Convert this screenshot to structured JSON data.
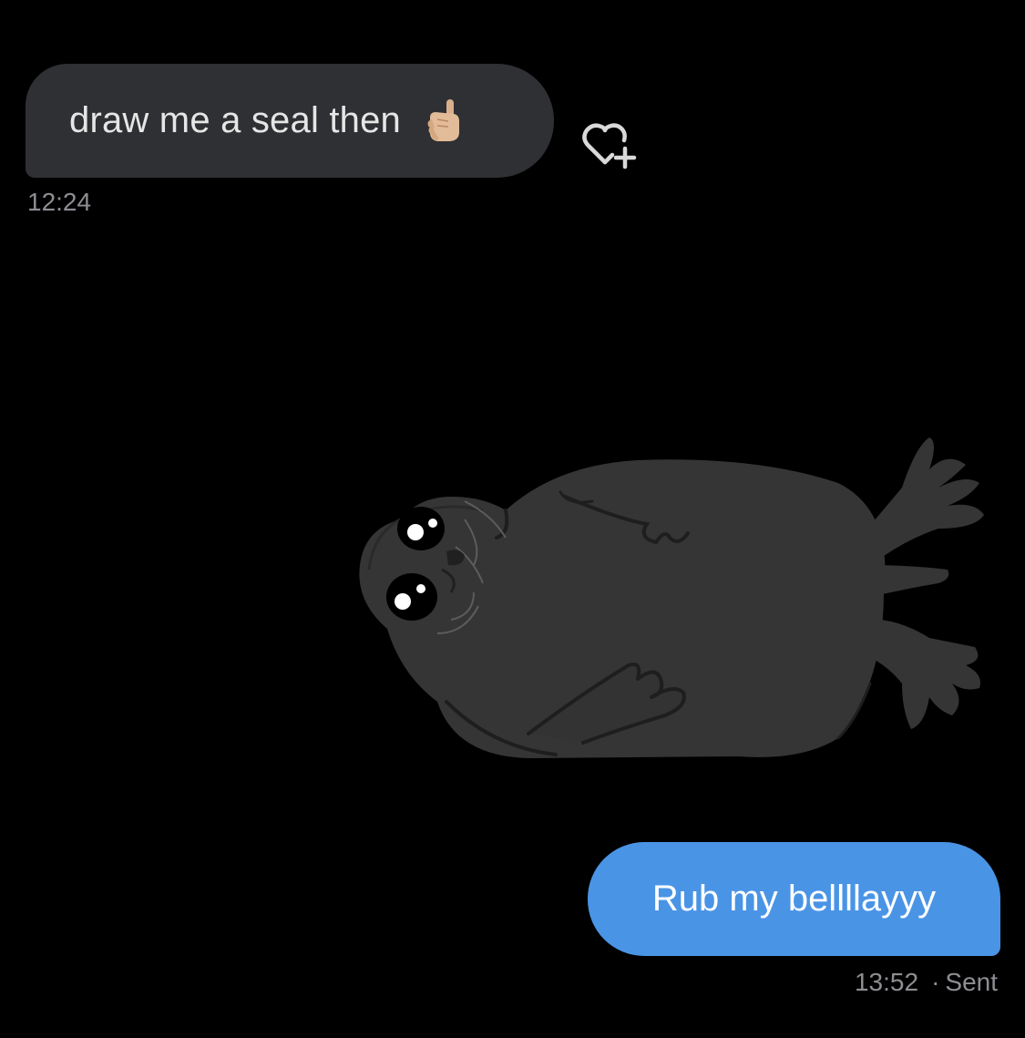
{
  "conversation": {
    "incoming": {
      "text": "draw me a seal then",
      "emoji": "backhand-index-pointing-up-emoji",
      "timestamp": "12:24",
      "reaction_icon": "heart-plus-icon"
    },
    "sent_image": {
      "icon": "seal-drawing"
    },
    "outgoing": {
      "text": "Rub my bellllayyy",
      "timestamp": "13:52",
      "separator": "·",
      "status": "Sent"
    }
  },
  "colors": {
    "background": "#000000",
    "incoming_bubble": "#2f3033",
    "outgoing_bubble": "#4a94e6",
    "meta_text": "#8e8e93",
    "seal_body": "#353536"
  }
}
